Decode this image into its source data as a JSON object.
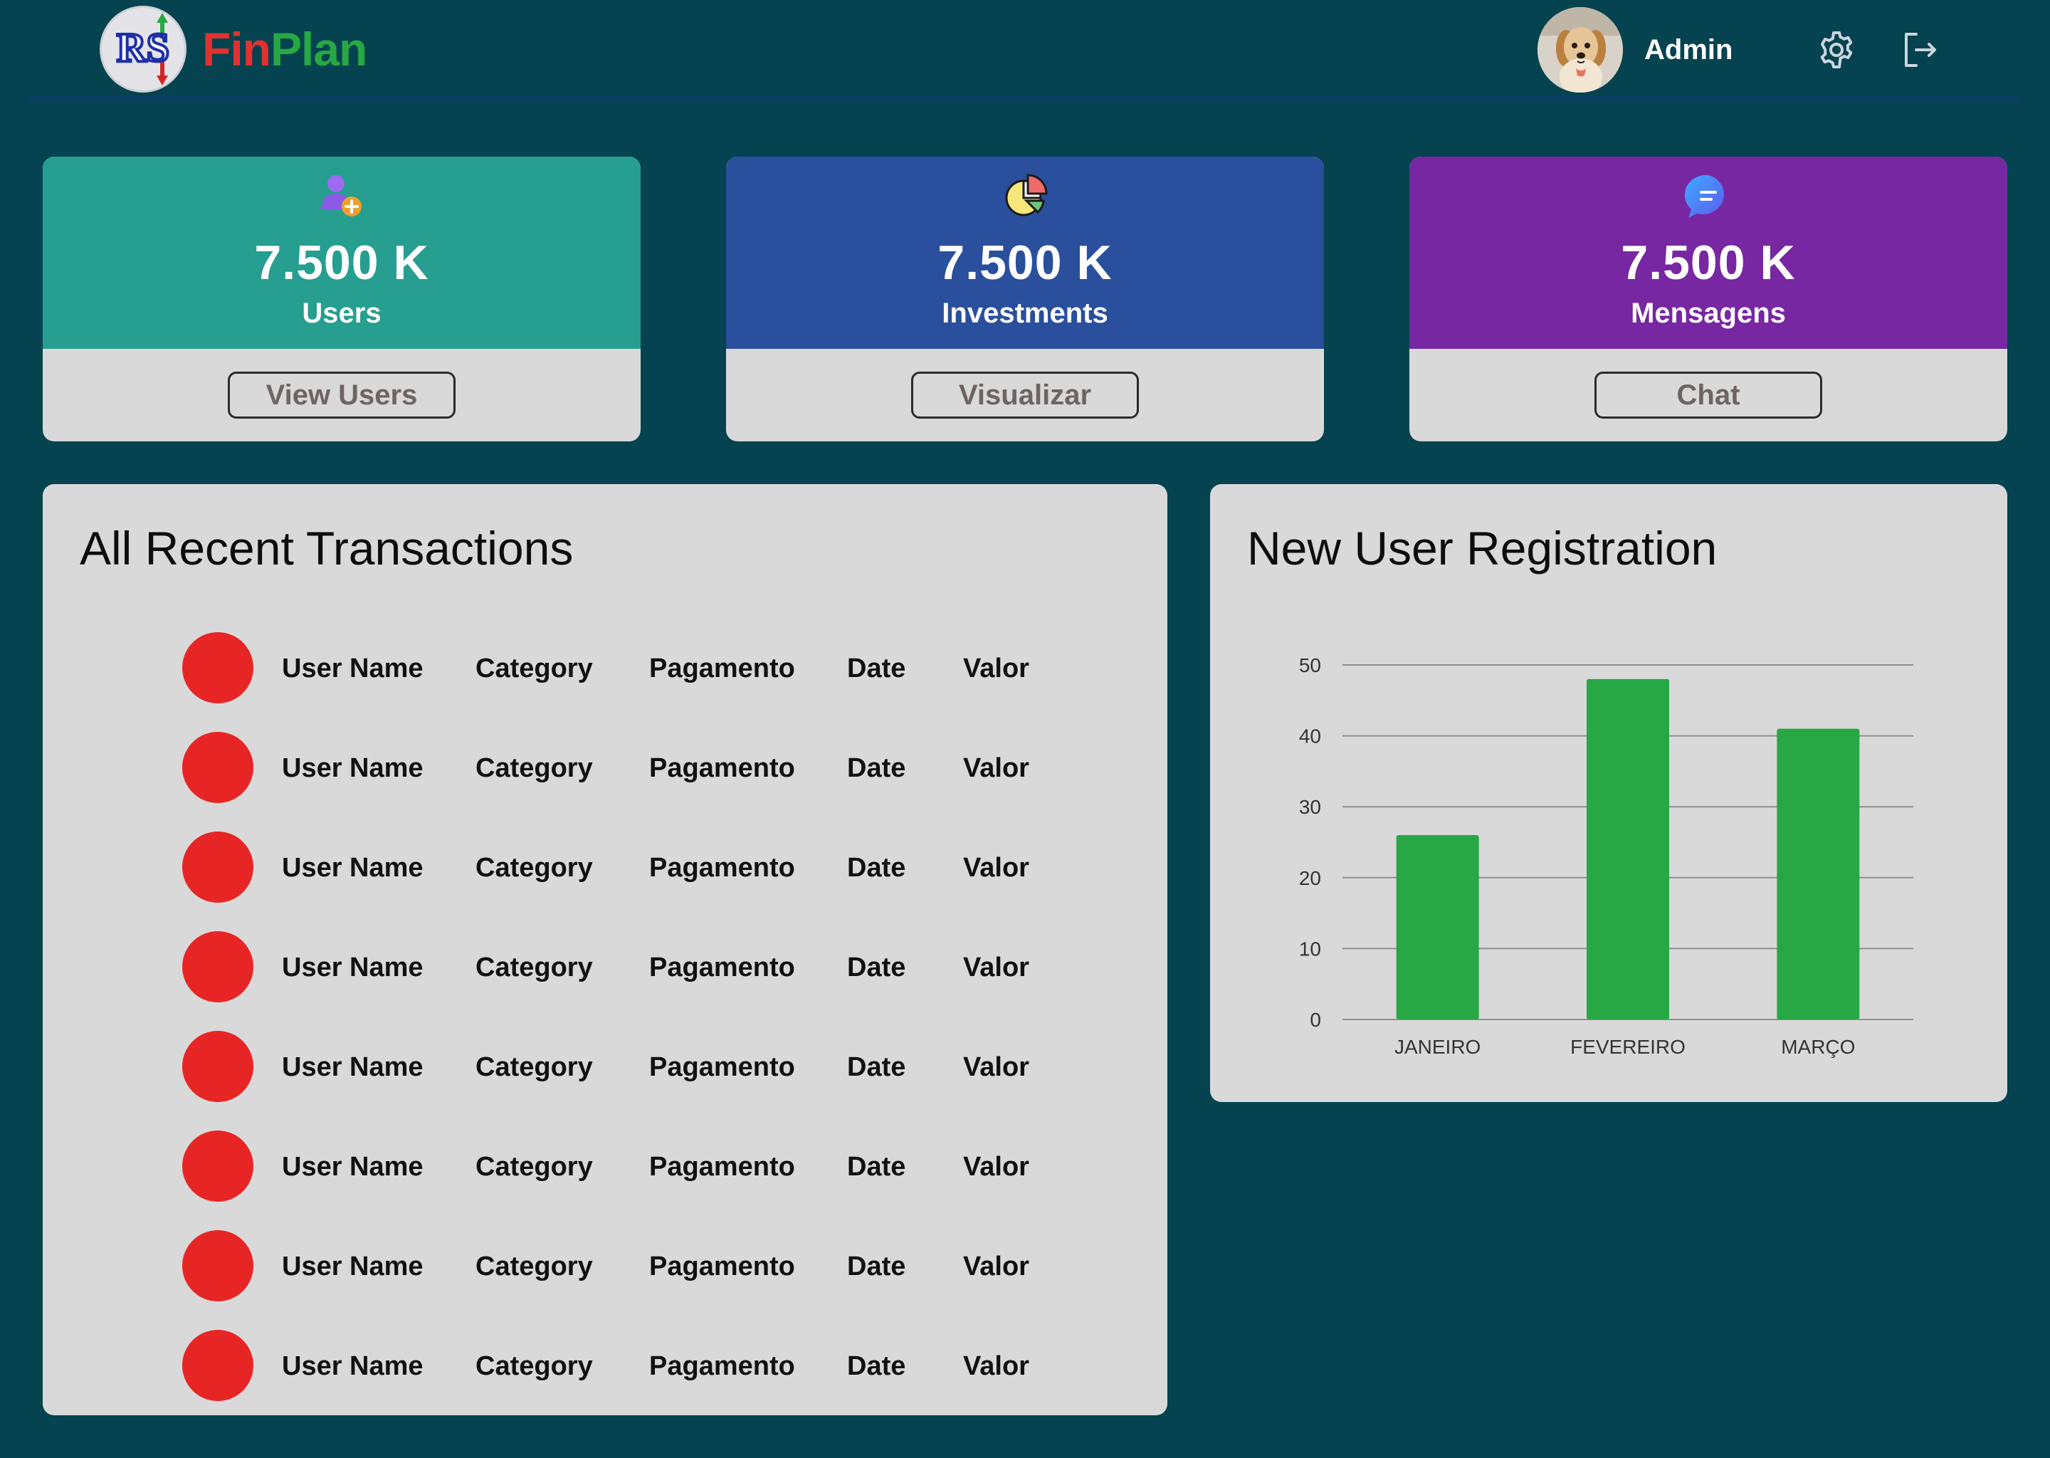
{
  "header": {
    "logo_initials": "RS",
    "brand_part1": "Fin",
    "brand_part2": "Plan",
    "user_name": "Admin"
  },
  "stats": [
    {
      "value": "7.500 K",
      "label": "Users",
      "button": "View Users",
      "color": "#269e90",
      "icon": "add-user-icon"
    },
    {
      "value": "7.500 K",
      "label": "Investments",
      "button": "Visualizar",
      "color": "#2a4f9c",
      "icon": "pie-chart-icon"
    },
    {
      "value": "7.500 K",
      "label": "Mensagens",
      "button": "Chat",
      "color": "#7727a1",
      "icon": "chat-bubble-icon"
    }
  ],
  "transactions": {
    "title": "All Recent Transactions",
    "rows": [
      {
        "user": "User Name",
        "category": "Category",
        "payment": "Pagamento",
        "date": "Date",
        "value": "Valor"
      },
      {
        "user": "User Name",
        "category": "Category",
        "payment": "Pagamento",
        "date": "Date",
        "value": "Valor"
      },
      {
        "user": "User Name",
        "category": "Category",
        "payment": "Pagamento",
        "date": "Date",
        "value": "Valor"
      },
      {
        "user": "User Name",
        "category": "Category",
        "payment": "Pagamento",
        "date": "Date",
        "value": "Valor"
      },
      {
        "user": "User Name",
        "category": "Category",
        "payment": "Pagamento",
        "date": "Date",
        "value": "Valor"
      },
      {
        "user": "User Name",
        "category": "Category",
        "payment": "Pagamento",
        "date": "Date",
        "value": "Valor"
      },
      {
        "user": "User Name",
        "category": "Category",
        "payment": "Pagamento",
        "date": "Date",
        "value": "Valor"
      },
      {
        "user": "User Name",
        "category": "Category",
        "payment": "Pagamento",
        "date": "Date",
        "value": "Valor"
      }
    ]
  },
  "registration": {
    "title": "New User Registration"
  },
  "chart_data": {
    "type": "bar",
    "title": "New User Registration",
    "categories": [
      "JANEIRO",
      "FEVEREIRO",
      "MARÇO"
    ],
    "values": [
      26,
      48,
      41
    ],
    "ylim": [
      0,
      50
    ],
    "yticks": [
      0,
      10,
      20,
      30,
      40,
      50
    ],
    "grid": true,
    "bar_color": "#27a844"
  }
}
